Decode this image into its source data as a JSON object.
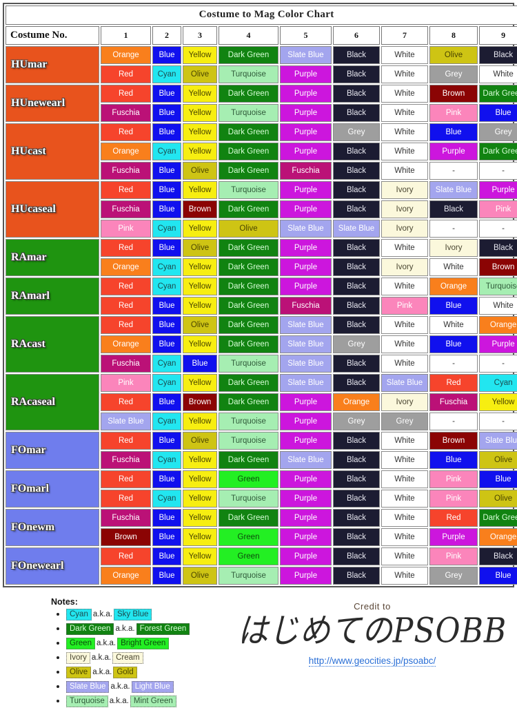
{
  "title": "Costume to Mag Color Chart",
  "header": {
    "label": "Costume No.",
    "numbers": [
      "1",
      "2",
      "3",
      "4",
      "5",
      "6",
      "7",
      "8",
      "9"
    ]
  },
  "palette": {
    "Orange": {
      "bg": "#f97f1c",
      "fg": "#ffffff"
    },
    "Red": {
      "bg": "#f6442c",
      "fg": "#ffffff"
    },
    "Blue": {
      "bg": "#1010ee",
      "fg": "#ffffff"
    },
    "Cyan": {
      "bg": "#22e6f0",
      "fg": "#1c4a4e"
    },
    "Yellow": {
      "bg": "#f7ee11",
      "fg": "#4a4500"
    },
    "Olive": {
      "bg": "#cec414",
      "fg": "#4a4500"
    },
    "Dark Green": {
      "bg": "#118311",
      "fg": "#d8ffd8"
    },
    "Green": {
      "bg": "#23ef23",
      "fg": "#0c4a0c"
    },
    "Turquoise": {
      "bg": "#a6eeb2",
      "fg": "#2f5a39"
    },
    "Slate Blue": {
      "bg": "#a3a5ee",
      "fg": "#ffffff"
    },
    "Purple": {
      "bg": "#cc16dd",
      "fg": "#ffffff"
    },
    "Fuschia": {
      "bg": "#bb1177",
      "fg": "#ffffff"
    },
    "Pink": {
      "bg": "#fb85bb",
      "fg": "#ffffff"
    },
    "Black": {
      "bg": "#1c1c32",
      "fg": "#e8e8f0"
    },
    "White": {
      "bg": "#ffffff",
      "fg": "#333333"
    },
    "Ivory": {
      "bg": "#fbf8dc",
      "fg": "#4a4631"
    },
    "Grey": {
      "bg": "#9e9e9e",
      "fg": "#ffffff"
    },
    "Brown": {
      "bg": "#8b0404",
      "fg": "#ffffff"
    },
    "-": {
      "bg": "#ffffff",
      "fg": "#333333"
    }
  },
  "class_colors": {
    "hunter": "#e8531d",
    "ranger": "#1f9410",
    "force": "#6f7ded"
  },
  "chart_data": {
    "type": "table",
    "title": "Costume to Mag Color Chart",
    "columns": [
      "Costume No.",
      "1",
      "2",
      "3",
      "4",
      "5",
      "6",
      "7",
      "8",
      "9"
    ],
    "rows": [
      {
        "name": "HUmar",
        "group": "hunter",
        "lines": [
          [
            "Orange",
            "Blue",
            "Yellow",
            "Dark Green",
            "Slate Blue",
            "Black",
            "White",
            "Olive",
            "Black"
          ],
          [
            "Red",
            "Cyan",
            "Olive",
            "Turquoise",
            "Purple",
            "Black",
            "White",
            "Grey",
            "White"
          ]
        ]
      },
      {
        "name": "HUnewearl",
        "group": "hunter",
        "lines": [
          [
            "Red",
            "Blue",
            "Yellow",
            "Dark Green",
            "Purple",
            "Black",
            "White",
            "Brown",
            "Dark Green"
          ],
          [
            "Fuschia",
            "Blue",
            "Yellow",
            "Turquoise",
            "Purple",
            "Black",
            "White",
            "Pink",
            "Blue"
          ]
        ]
      },
      {
        "name": "HUcast",
        "group": "hunter",
        "lines": [
          [
            "Red",
            "Blue",
            "Yellow",
            "Dark Green",
            "Purple",
            "Grey",
            "White",
            "Blue",
            "Grey"
          ],
          [
            "Orange",
            "Cyan",
            "Yellow",
            "Dark Green",
            "Purple",
            "Black",
            "White",
            "Purple",
            "Dark Green"
          ],
          [
            "Fuschia",
            "Blue",
            "Olive",
            "Dark Green",
            "Fuschia",
            "Black",
            "White",
            "-",
            "-"
          ]
        ]
      },
      {
        "name": "HUcaseal",
        "group": "hunter",
        "lines": [
          [
            "Red",
            "Blue",
            "Yellow",
            "Turquoise",
            "Purple",
            "Black",
            "Ivory",
            "Slate Blue",
            "Purple"
          ],
          [
            "Fuschia",
            "Blue",
            "Brown",
            "Dark Green",
            "Purple",
            "Black",
            "Ivory",
            "Black",
            "Pink"
          ],
          [
            "Pink",
            "Cyan",
            "Yellow",
            "Olive",
            "Slate Blue",
            "Slate Blue",
            "Ivory",
            "-",
            "-"
          ]
        ]
      },
      {
        "name": "RAmar",
        "group": "ranger",
        "lines": [
          [
            "Red",
            "Blue",
            "Olive",
            "Dark Green",
            "Purple",
            "Black",
            "White",
            "Ivory",
            "Black"
          ],
          [
            "Orange",
            "Cyan",
            "Yellow",
            "Dark Green",
            "Purple",
            "Black",
            "Ivory",
            "White",
            "Brown"
          ]
        ]
      },
      {
        "name": "RAmarl",
        "group": "ranger",
        "lines": [
          [
            "Red",
            "Cyan",
            "Yellow",
            "Dark Green",
            "Purple",
            "Black",
            "White",
            "Orange",
            "Turquoise"
          ],
          [
            "Red",
            "Blue",
            "Yellow",
            "Dark Green",
            "Fuschia",
            "Black",
            "Pink",
            "Blue",
            "White"
          ]
        ]
      },
      {
        "name": "RAcast",
        "group": "ranger",
        "lines": [
          [
            "Red",
            "Blue",
            "Olive",
            "Dark Green",
            "Slate Blue",
            "Black",
            "White",
            "White",
            "Orange"
          ],
          [
            "Orange",
            "Blue",
            "Yellow",
            "Dark Green",
            "Slate Blue",
            "Grey",
            "White",
            "Blue",
            "Purple"
          ],
          [
            "Fuschia",
            "Cyan",
            "Blue",
            "Turquoise",
            "Slate Blue",
            "Black",
            "White",
            "-",
            "-"
          ]
        ]
      },
      {
        "name": "RAcaseal",
        "group": "ranger",
        "lines": [
          [
            "Pink",
            "Cyan",
            "Yellow",
            "Dark Green",
            "Slate Blue",
            "Black",
            "Slate Blue",
            "Red",
            "Cyan"
          ],
          [
            "Red",
            "Blue",
            "Brown",
            "Dark Green",
            "Purple",
            "Orange",
            "Ivory",
            "Fuschia",
            "Yellow"
          ],
          [
            "Slate Blue",
            "Cyan",
            "Yellow",
            "Turquoise",
            "Purple",
            "Grey",
            "Grey",
            "-",
            "-"
          ]
        ]
      },
      {
        "name": "FOmar",
        "group": "force",
        "lines": [
          [
            "Red",
            "Blue",
            "Olive",
            "Turquoise",
            "Purple",
            "Black",
            "White",
            "Brown",
            "Slate Blue"
          ],
          [
            "Fuschia",
            "Cyan",
            "Yellow",
            "Dark Green",
            "Slate Blue",
            "Black",
            "White",
            "Blue",
            "Olive"
          ]
        ]
      },
      {
        "name": "FOmarl",
        "group": "force",
        "lines": [
          [
            "Red",
            "Blue",
            "Yellow",
            "Green",
            "Purple",
            "Black",
            "White",
            "Pink",
            "Blue"
          ],
          [
            "Red",
            "Cyan",
            "Yellow",
            "Turquoise",
            "Purple",
            "Black",
            "White",
            "Pink",
            "Olive"
          ]
        ]
      },
      {
        "name": "FOnewm",
        "group": "force",
        "lines": [
          [
            "Fuschia",
            "Blue",
            "Yellow",
            "Dark Green",
            "Purple",
            "Black",
            "White",
            "Red",
            "Dark Green"
          ],
          [
            "Brown",
            "Blue",
            "Yellow",
            "Green",
            "Purple",
            "Black",
            "White",
            "Purple",
            "Orange"
          ]
        ]
      },
      {
        "name": "FOnewearl",
        "group": "force",
        "lines": [
          [
            "Red",
            "Blue",
            "Yellow",
            "Green",
            "Purple",
            "Black",
            "White",
            "Pink",
            "Black"
          ],
          [
            "Orange",
            "Blue",
            "Olive",
            "Turquoise",
            "Purple",
            "Black",
            "White",
            "Grey",
            "Blue"
          ]
        ]
      }
    ]
  },
  "notes": {
    "title": "Notes:",
    "aka": "a.k.a.",
    "items": [
      {
        "from": "Cyan",
        "to": "Sky Blue"
      },
      {
        "from": "Dark Green",
        "to": "Forest Green"
      },
      {
        "from": "Green",
        "to": "Bright Green"
      },
      {
        "from": "Ivory",
        "to": "Cream"
      },
      {
        "from": "Olive",
        "to": "Gold"
      },
      {
        "from": "Slate Blue",
        "to": "Light Blue"
      },
      {
        "from": "Turquoise",
        "to": "Mint Green"
      }
    ]
  },
  "credit": {
    "label": "Credit to",
    "site_name": "はじめてのPSOBB",
    "url": "http://www.geocities.jp/psoabc/"
  }
}
